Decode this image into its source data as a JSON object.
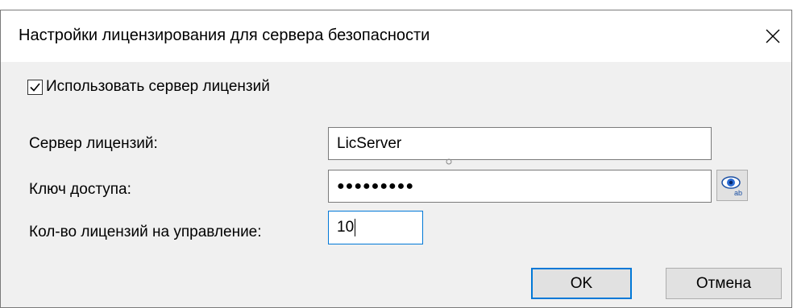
{
  "window": {
    "title": "Настройки лицензирования для сервера безопасности",
    "close_icon": "close-icon"
  },
  "use_license_server": {
    "label": "Использовать сервер лицензий",
    "checked": true
  },
  "license_server": {
    "label": "Сервер лицензий:",
    "value": "LicServer"
  },
  "access_key": {
    "label": "Ключ доступа:",
    "masked_value": "●●●●●●●●●",
    "reveal_icon": "eye-icon"
  },
  "license_count": {
    "label": "Кол-во лицензий на управление:",
    "value": "10"
  },
  "buttons": {
    "ok": "OK",
    "cancel": "Отмена"
  },
  "colors": {
    "accent": "#0078d7",
    "dialog_bg": "#f0f0f0"
  }
}
